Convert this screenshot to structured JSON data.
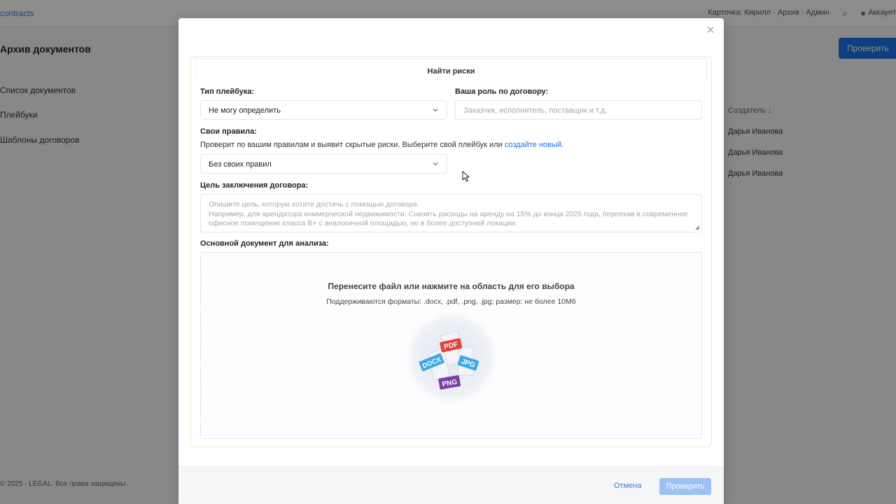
{
  "background": {
    "logo": "contracts",
    "header_right": "Карточка: Кирилл · Архив · Админ",
    "user": "Аккаунт",
    "page_title": "Архив документов",
    "sidebar": [
      "Список документов",
      "Плейбуки",
      "Шаблоны договоров"
    ],
    "new_button": "Проверить",
    "table_head": "Создатель ↓",
    "table_cells": [
      "Дарья Иванова",
      "Дарья Иванова",
      "Дарья Иванова"
    ],
    "footer": "© 2025 · LEGAL. Все права защищены."
  },
  "modal": {
    "title": "Найти риски",
    "playbook_type": {
      "label": "Тип плейбука:",
      "value": "Не могу определить"
    },
    "role": {
      "label": "Ваша роль по договору:",
      "placeholder": "Заказчик, исполнитель, поставщик и т.д."
    },
    "own_rules": {
      "label": "Свои правила:",
      "helper": "Проверит по вашим правилам и выявит скрытые риски. Выберите свой плейбук или",
      "link": "создайте новый",
      "helper_end": ".",
      "value": "Без своих правил"
    },
    "purpose": {
      "label": "Цель заключения договора:",
      "placeholder_lines": [
        "Опишите цель, которую хотите достичь с помощью договора.",
        "Например, для арендатора коммерческой недвижимости: Снизить расходы на аренду на 15% до конца 2025 года, переехав в современное",
        "офисное помещение класса B+ с аналогичной площадью, но в более доступной локации."
      ]
    },
    "document": {
      "label": "Основной документ для анализа:",
      "drop_title": "Перенесите файл или нажмите на область для его выбора",
      "drop_sub": "Поддерживаются форматы: .docx, .pdf, .png, .jpg; размер: не более 10Мб",
      "badges": [
        "PDF",
        "DOCX",
        "JPG",
        "PNG"
      ]
    },
    "cancel_label": "Отмена",
    "submit_label": "Проверить"
  },
  "colors": {
    "accent": "#1a73e8",
    "submit_disabled": "#9cc2f3",
    "pdf": "#e0453a",
    "docx": "#3ea9e6",
    "jpg": "#3ea9e6",
    "png": "#7a3fa6"
  }
}
